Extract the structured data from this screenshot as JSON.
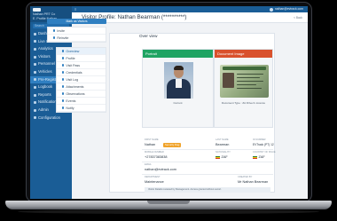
{
  "sidebar": {
    "brand_line1": "Nathan PRT Co",
    "brand_line2": "E. Profile Nathan",
    "search": "Search",
    "items": [
      {
        "label": "Dashboard",
        "icon": "home-icon"
      },
      {
        "label": "Live Chat",
        "icon": "chat-icon"
      },
      {
        "label": "Analytics",
        "icon": "chart-icon"
      },
      {
        "label": "Visitors",
        "icon": "users-icon"
      },
      {
        "label": "Personnel",
        "icon": "person-icon"
      },
      {
        "label": "Vehicles",
        "icon": "car-icon"
      },
      {
        "label": "Pre-Register",
        "icon": "calendar-icon"
      },
      {
        "label": "Logbook",
        "icon": "book-icon"
      },
      {
        "label": "Reports",
        "icon": "report-icon"
      },
      {
        "label": "Notifications",
        "icon": "bell-icon"
      },
      {
        "label": "Admin",
        "icon": "shield-icon"
      },
      {
        "label": "Configuration",
        "icon": "gear-icon"
      }
    ],
    "active_index": 6
  },
  "topbar": {
    "menu_icon": "menu-icon",
    "user_email": "nathan@evtrack.com"
  },
  "page": {
    "title": "Visitor Profile: Nathan Bearman (**********)",
    "back_label": "< Back"
  },
  "leftcol": {
    "add_button": "Mark as Visitors",
    "top_tabs": [
      "Invite",
      "Reinvite"
    ],
    "tabs": [
      "Overview",
      "Profile",
      "Visit Pass",
      "Credentials",
      "Visit Log",
      "Attachments",
      "Observations",
      "Events",
      "Notify"
    ],
    "active_tab": 0
  },
  "main": {
    "overview_title": "Over view",
    "portrait_title": "Portrait",
    "portrait_caption": "Current",
    "document_title": "Document Image",
    "document_caption": "Document Type : ZA Driver's Licence",
    "fields": {
      "first_name_label": "FIRST NAME",
      "first_name": "Nathan",
      "status_badge": "Security Flag",
      "last_name_label": "LAST NAME",
      "last_name": "Bearman",
      "id_label": "ID NUMBER",
      "id_value": "EVTrack (PT) 12",
      "mobile_label": "MOBILE NUMBER",
      "mobile": "+27837383838",
      "nationality_label": "NATIONALITY",
      "nationality": "ZAF",
      "country_label": "COUNTRY OF ISSUE",
      "country": "ZAF",
      "email_label": "EMAIL",
      "email": "nathan@evtrack.com",
      "department_label": "DEPARTMENT",
      "department": "Maintenance",
      "created_label": "CREATED BY",
      "created_by": "Mr Nathan Bearman"
    },
    "note": "Visitor Details reviewed by Management. Access granted without escort."
  },
  "colors": {
    "sidebar": "#1a5d96",
    "accent": "#2f7fc1",
    "portrait_header": "#1fa463",
    "document_header": "#d9512c",
    "badge": "#f0a32a"
  }
}
